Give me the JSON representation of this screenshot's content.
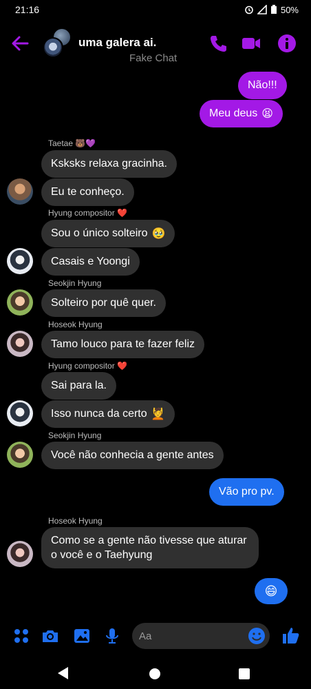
{
  "status": {
    "time": "21:16",
    "battery": "50%"
  },
  "header": {
    "title": "uma galera ai.",
    "subtitle": "Fake Chat"
  },
  "colors": {
    "accent": "#a319e6",
    "blue": "#1f6ff0",
    "incoming": "#303030"
  },
  "messages": {
    "m1": "Não!!!",
    "m2": "Meu deus",
    "m2_emoji": "😫",
    "s1": "Taetae 🐻💜",
    "m3": "Ksksks relaxa gracinha.",
    "m4": "Eu te conheço.",
    "s2": "Hyung compositor ❤️",
    "m5": "Sou o único solteiro",
    "m5_emoji": "🥹",
    "m6": "Casais e Yoongi",
    "s3": "Seokjin Hyung",
    "m7": "Solteiro por quê quer.",
    "s4": "Hoseok Hyung",
    "m8": "Tamo louco para te fazer feliz",
    "s5": "Hyung compositor ❤️",
    "m9": "Sai para la.",
    "m10": "Isso nunca da certo",
    "m10_emoji": "💆",
    "s6": "Seokjin Hyung",
    "m11": "Você não conhecia a gente antes",
    "m12": "Vão pro pv.",
    "s7": "Hoseok Hyung",
    "m13": "Como se a gente não tivesse que aturar o você e o Taehyung",
    "m14": "😄"
  },
  "composer": {
    "placeholder": "Aa"
  }
}
